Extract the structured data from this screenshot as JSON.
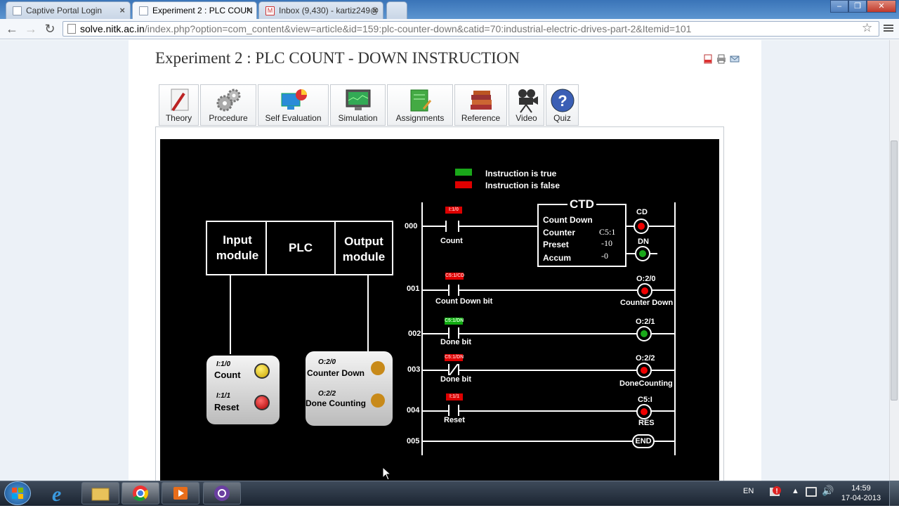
{
  "browser": {
    "tabs": [
      {
        "label": "Captive Portal Login"
      },
      {
        "label": "Experiment 2 : PLC COUN"
      },
      {
        "label": "Inbox (9,430) - kartiz249@"
      }
    ],
    "url_domain": "solve.nitk.ac.in",
    "url_rest": "/index.php?option=com_content&view=article&id=159:plc-counter-down&catid=70:industrial-electric-drives-part-2&Itemid=101"
  },
  "page": {
    "title": "Experiment 2 : PLC COUNT - DOWN INSTRUCTION",
    "nav": [
      "Theory",
      "Procedure",
      "Self Evaluation",
      "Simulation",
      "Assignments",
      "Reference",
      "Video",
      "Quiz"
    ]
  },
  "sim": {
    "legend_true": "Instruction is true",
    "legend_false": "Instruction is false",
    "blocks": {
      "input": "Input module",
      "plc": "PLC",
      "output": "Output module"
    },
    "inputs": [
      {
        "addr": "I:1/0",
        "name": "Count"
      },
      {
        "addr": "I:1/1",
        "name": "Reset"
      }
    ],
    "outputs": [
      {
        "addr": "O:2/0",
        "name": "Counter Down"
      },
      {
        "addr": "O:2/2",
        "name": "Done Counting"
      }
    ],
    "rungs": [
      "000",
      "001",
      "002",
      "003",
      "004",
      "005"
    ],
    "ctd": {
      "title": "CTD",
      "subtitle": "Count Down",
      "counter_label": "Counter",
      "counter_val": "C5:1",
      "preset_label": "Preset",
      "preset_val": "-10",
      "accum_label": "Accum",
      "accum_val": "-0",
      "cd": "CD",
      "dn": "DN"
    },
    "contacts": [
      "Count",
      "Count Down bit",
      "Done bit",
      "Done bit",
      "Reset"
    ],
    "contact_tags": [
      "I:1/0",
      "C5:1/CD",
      "C5:1/DN",
      "C5:1/DN",
      "I:1/1"
    ],
    "coils": [
      {
        "addr": "O:2/0",
        "name": "Counter Down"
      },
      {
        "addr": "O:2/1",
        "name": ""
      },
      {
        "addr": "O:2/2",
        "name": "DoneCounting"
      },
      {
        "addr": "C5:I",
        "name": "RES"
      },
      {
        "addr": "END",
        "name": ""
      }
    ]
  },
  "taskbar": {
    "lang": "EN",
    "time": "14:59",
    "date": "17-04-2013"
  },
  "colors": {
    "true": "#1aa81a",
    "false": "#e00000",
    "accent": "#3a74b8"
  }
}
